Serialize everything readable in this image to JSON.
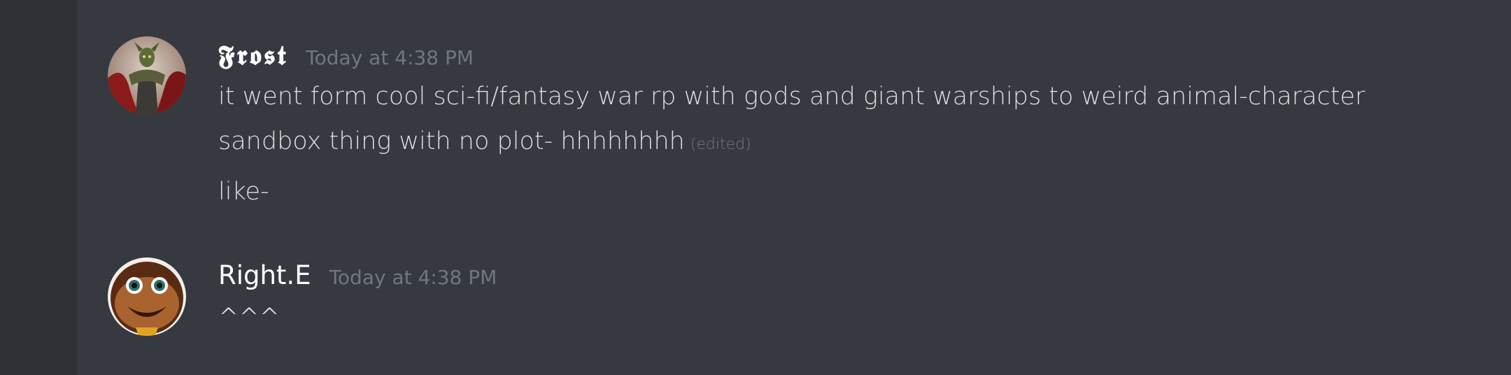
{
  "messages": [
    {
      "username": "𝕱𝖗𝖔𝖘𝖙",
      "timestamp": "Today at 4:38 PM",
      "lines": [
        "it went form cool sci-fi/fantasy war rp with gods and giant warships to weird animal-character",
        "sandbox  thing with no plot- hhhhhhhh",
        "like-"
      ],
      "edited_label": "(edited)"
    },
    {
      "username": "Right.E",
      "timestamp": "Today at 4:38 PM",
      "lines": [
        "^^^"
      ]
    }
  ],
  "colors": {
    "background": "#36393f",
    "sidebar": "#2f3136",
    "username": "#ffffff",
    "text": "#dcddde",
    "muted": "#72767d"
  },
  "icons": {
    "avatar_1": "armored-figure-avatar",
    "avatar_2": "cartoon-face-avatar"
  }
}
